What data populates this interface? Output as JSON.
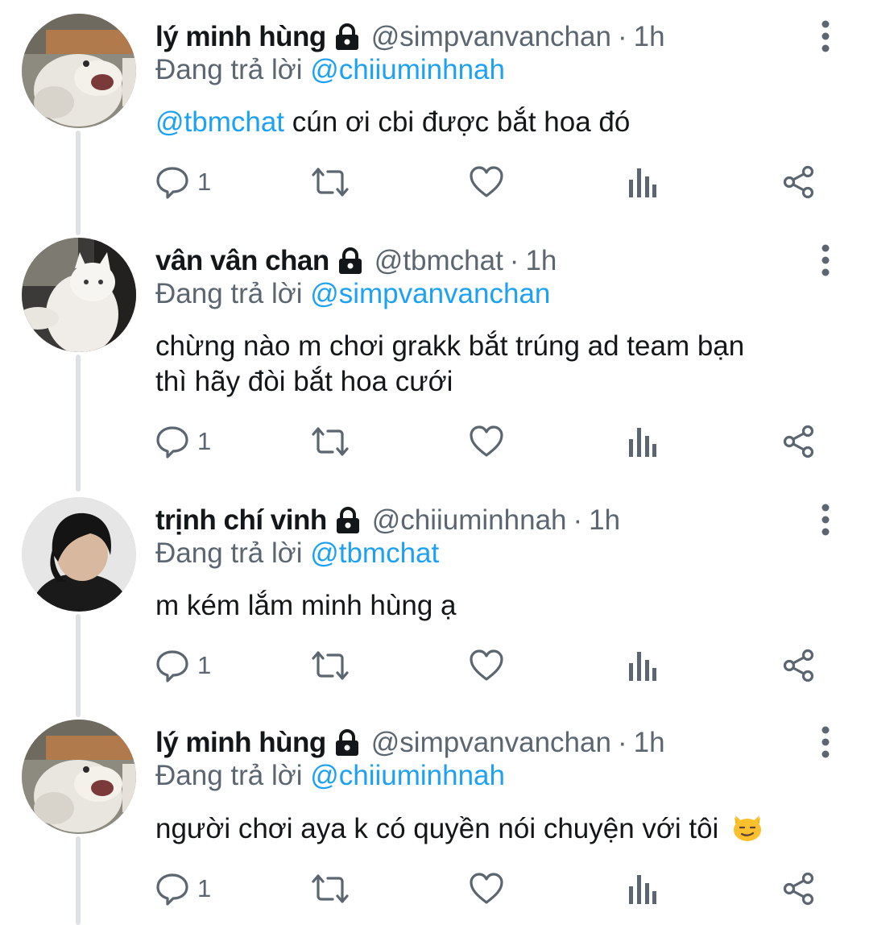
{
  "accent_color": "#1da1f2",
  "muted_color": "#5b6670",
  "tweets": [
    {
      "name": "lý minh hùng",
      "handle": "@simpvanvanchan",
      "separator": "·",
      "time": "1h",
      "replying_prefix": "Đang trả lời",
      "replying_to": "@chiiuminhnah",
      "mention": "@tbmchat",
      "text": " cún ơi cbi được bắt hoa đó",
      "reply_count": "1",
      "avatar": "cat-meme"
    },
    {
      "name": "vân vân chan",
      "handle": "@tbmchat",
      "separator": "·",
      "time": "1h",
      "replying_prefix": "Đang trả lời",
      "replying_to": "@simpvanvanchan",
      "text_line1": "chừng nào m chơi grakk bắt trúng ad team bạn",
      "text_line2": "thì hãy đòi bắt hoa cưới",
      "reply_count": "1",
      "avatar": "white-cat"
    },
    {
      "name": "trịnh chí vinh",
      "handle": "@chiiuminhnah",
      "separator": "·",
      "time": "1h",
      "replying_prefix": "Đang trả lời",
      "replying_to": "@tbmchat",
      "text": "m kém lắm minh hùng ạ",
      "reply_count": "1",
      "avatar": "dark-hair-person"
    },
    {
      "name": "lý minh hùng",
      "handle": "@simpvanvanchan",
      "separator": "·",
      "time": "1h",
      "replying_prefix": "Đang trả lời",
      "replying_to": "@chiiuminhnah",
      "text": "người chơi aya k có quyền nói chuyện với tôi",
      "emoji": "smirking-cat-emoji",
      "reply_count": "1",
      "avatar": "cat-meme"
    }
  ]
}
